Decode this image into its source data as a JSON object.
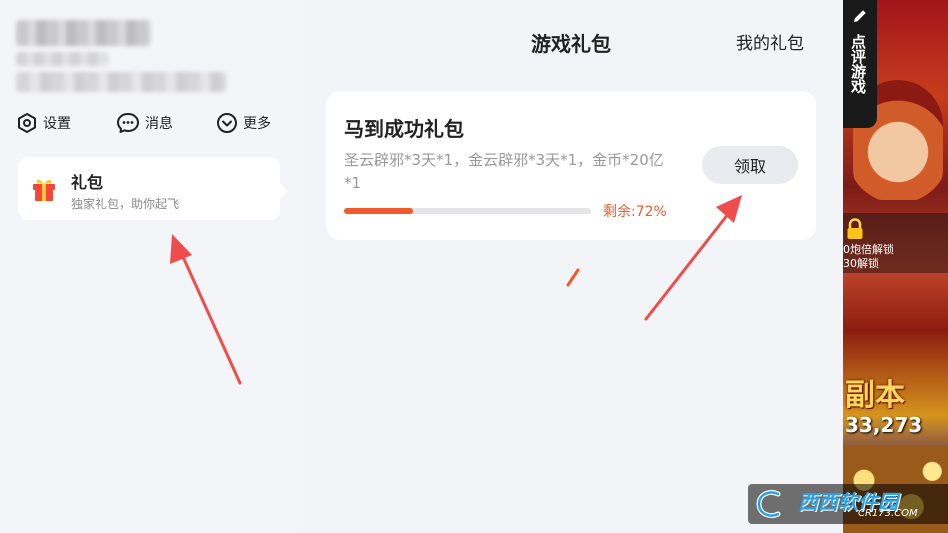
{
  "profile": {
    "name": "",
    "id": "",
    "info": ""
  },
  "quick_actions": {
    "settings_label": "设置",
    "messages_label": "消息",
    "more_label": "更多"
  },
  "sidebar": {
    "gift_entry": {
      "title": "礼包",
      "subtitle": "独家礼包，助你起飞"
    }
  },
  "main": {
    "title": "游戏礼包",
    "my_gifts_link": "我的礼包",
    "gift_pack": {
      "title": "马到成功礼包",
      "description": "圣云辟邪*3天*1，金云辟邪*3天*1，金币*20亿*1",
      "remaining_label": "剩余:72%",
      "remaining_fraction": 0.28,
      "claim_label": "领取"
    }
  },
  "right_banner": {
    "review_label": "点评游戏",
    "unlock_lines": "0炮倍解锁\n30解锁",
    "headline": "副本",
    "number": "33,273"
  },
  "watermark": {
    "title": "西西软件园",
    "url": "CR173.COM"
  },
  "colors": {
    "accent": "#f15a2b",
    "card": "#ffffff",
    "background": "#f3f4f7"
  }
}
